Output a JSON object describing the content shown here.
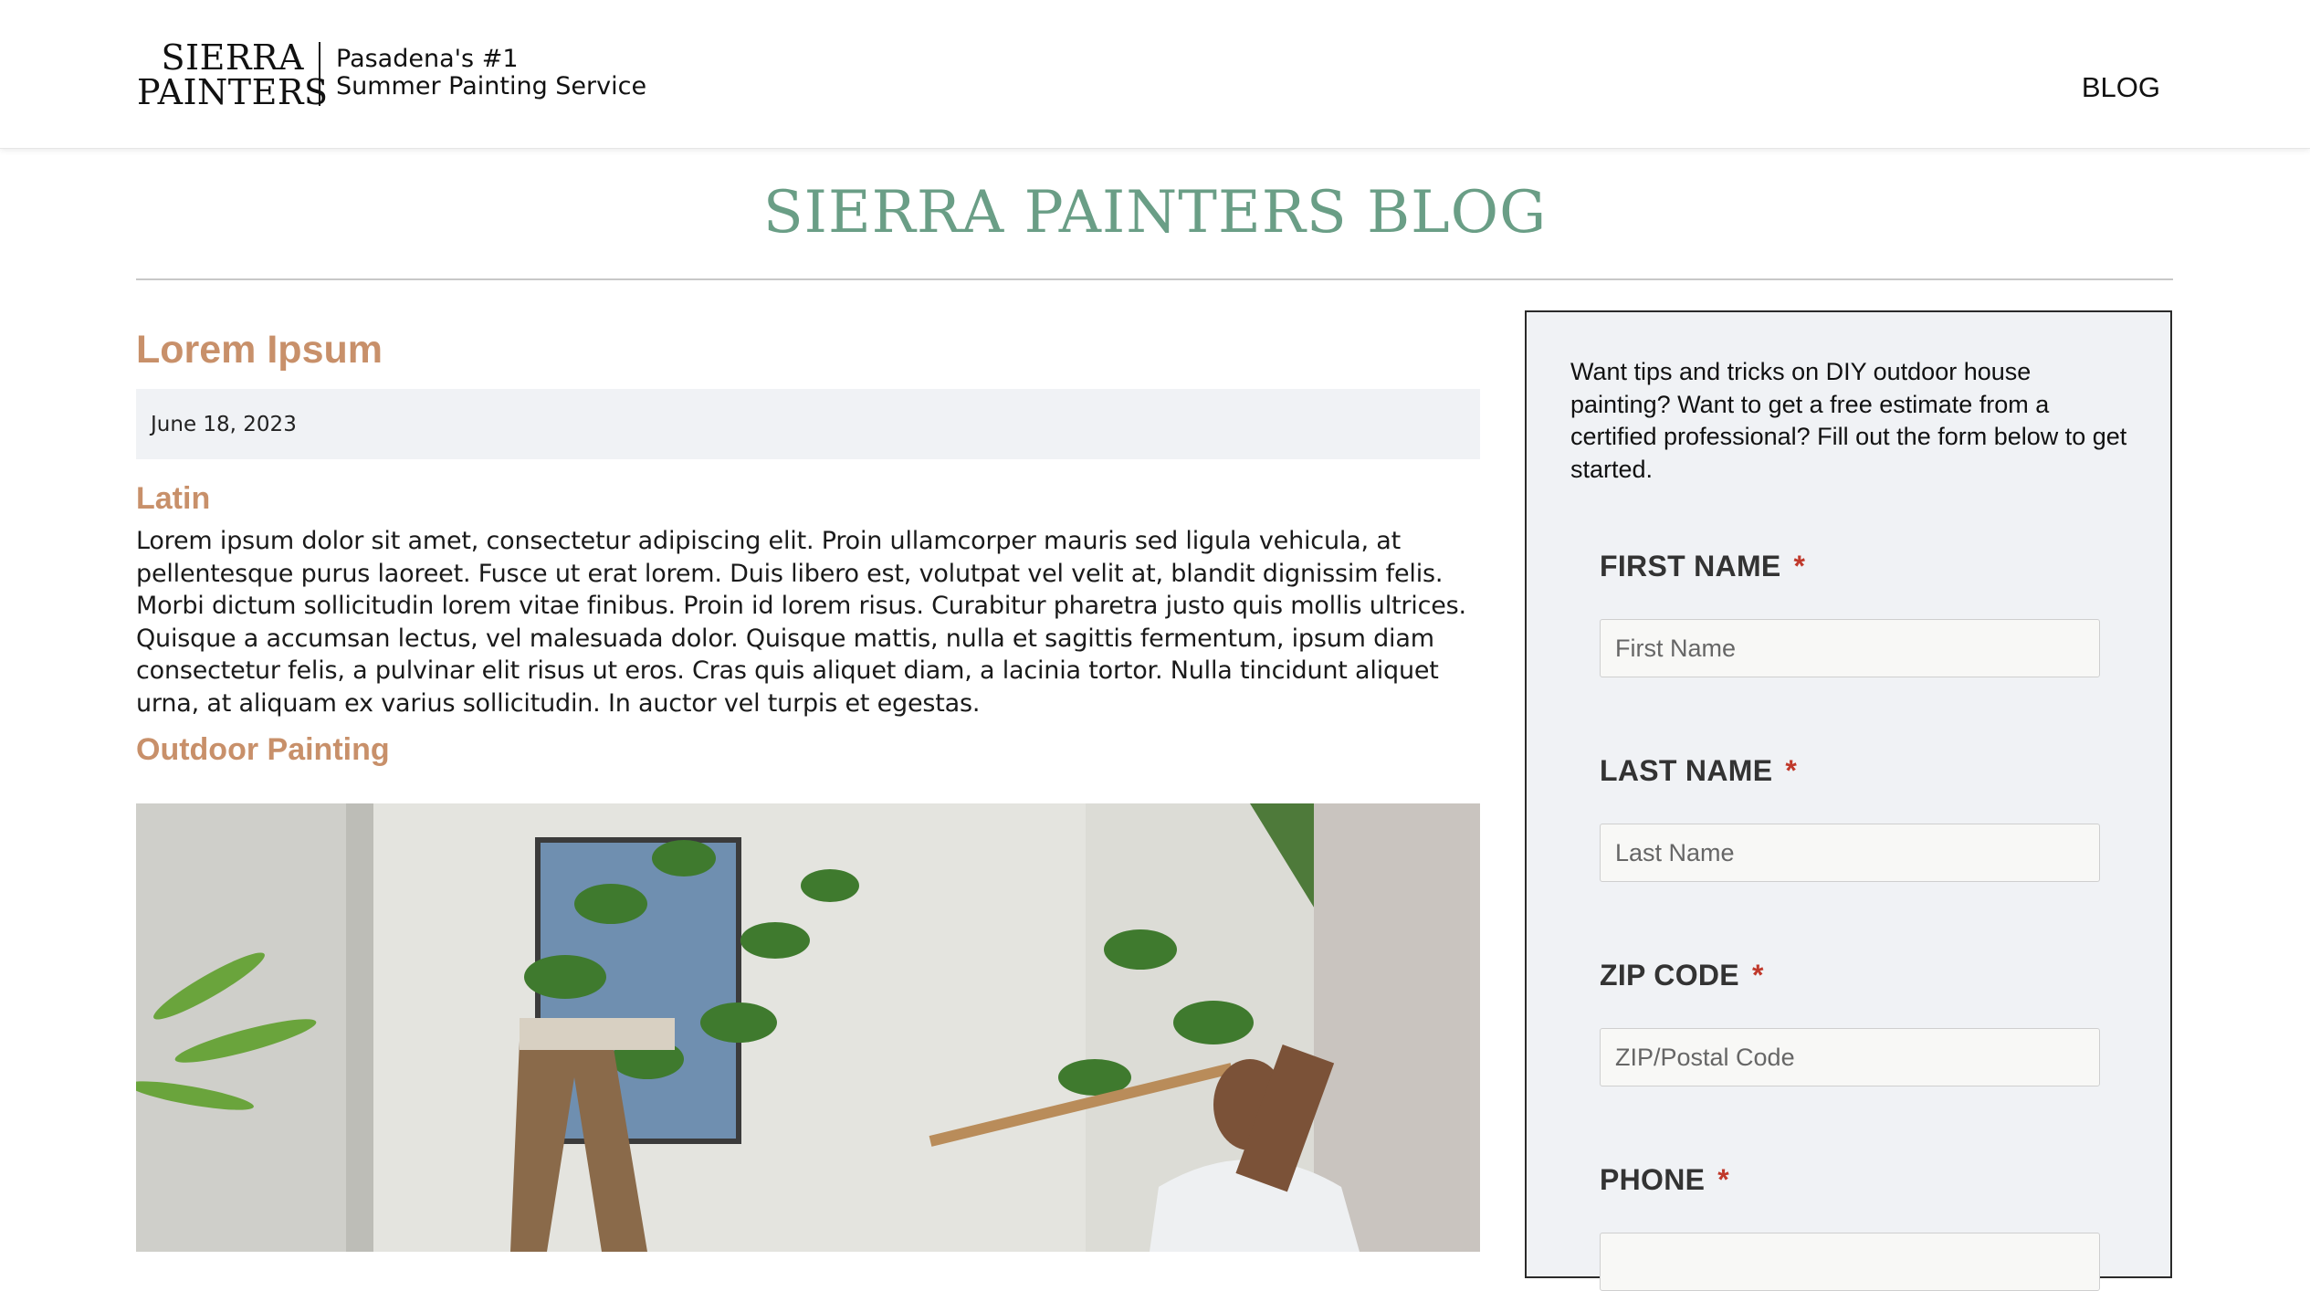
{
  "header": {
    "logo_line1": "SIERRA",
    "logo_line2": "PAINTERS",
    "tagline_line1": "Pasadena's #1",
    "tagline_line2": "Summer Painting Service",
    "nav_blog": "BLOG"
  },
  "page_title": "SIERRA PAINTERS BLOG",
  "post": {
    "title": "Lorem Ipsum",
    "date": "June 18, 2023",
    "section1_heading": "Latin",
    "section1_body": "Lorem ipsum dolor sit amet, consectetur adipiscing elit. Proin ullamcorper mauris sed ligula vehicula, at pellentesque purus laoreet. Fusce ut erat lorem. Duis libero est, volutpat vel velit at, blandit dignissim felis. Morbi dictum sollicitudin lorem vitae finibus. Proin id lorem risus. Curabitur pharetra justo quis mollis ultrices. Quisque a accumsan lectus, vel malesuada dolor. Quisque mattis, nulla et sagittis fermentum, ipsum diam consectetur felis, a pulvinar elit risus ut eros. Cras quis aliquet diam, a lacinia tortor. Nulla tincidunt aliquet urna, at aliquam ex varius sollicitudin. In auctor vel turpis et egestas.",
    "section2_heading": "Outdoor Painting"
  },
  "form": {
    "intro": "Want tips and tricks on DIY outdoor house painting? Want to get a free estimate from a certified professional? Fill out the form below to get started.",
    "required_marker": "*",
    "fields": [
      {
        "label": "FIRST NAME",
        "placeholder": "First Name"
      },
      {
        "label": "LAST NAME",
        "placeholder": "Last Name"
      },
      {
        "label": "ZIP CODE",
        "placeholder": "ZIP/Postal Code"
      },
      {
        "label": "PHONE",
        "placeholder": ""
      }
    ]
  },
  "colors": {
    "accent_green": "#6a9e86",
    "accent_tan": "#c8906a",
    "required_red": "#c0392b"
  }
}
